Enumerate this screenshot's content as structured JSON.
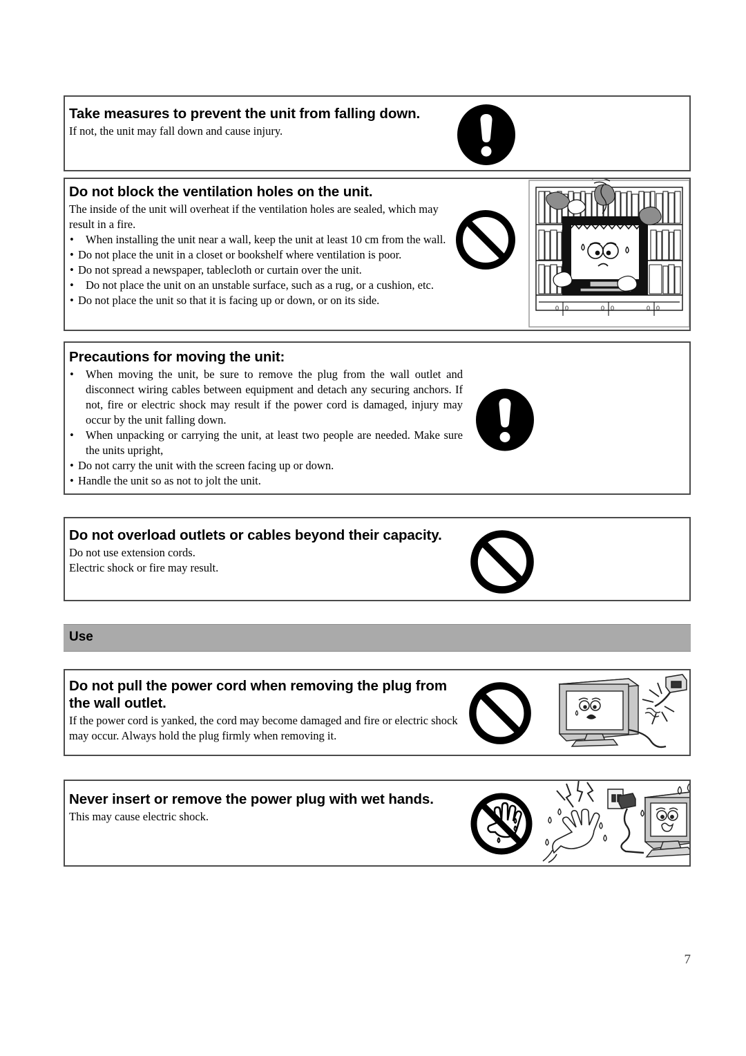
{
  "document": {
    "page_number": "7",
    "section_header": "Use"
  },
  "boxes": [
    {
      "id": "falling-down",
      "heading": "Take measures to prevent the unit from falling down.",
      "body": "If not, the unit may fall down and cause injury.",
      "icon": "exclamation-mark-icon"
    },
    {
      "id": "ventilation-holes",
      "heading": "Do not block the ventilation holes on the unit.",
      "body": "The inside of the unit will overheat if the ventilation holes are sealed, which may result in a fire.",
      "bullets": [
        "When installing the unit near a wall, keep the unit at least 10 cm from the wall.",
        "Do not place the unit in a closet or bookshelf where ventilation is poor.",
        "Do not spread a newspaper, tablecloth or curtain over the unit.",
        "Do not place the unit on an unstable surface, such as a rug, or a cushion, etc.",
        "Do not place the unit so that it is facing up or down, or on its side."
      ],
      "icon": "prohibition-icon",
      "illustration": "tv-in-bookshelf-overheating-illustration"
    },
    {
      "id": "moving-unit",
      "heading": "Precautions for moving the unit:",
      "bullets": [
        "When moving the unit, be sure to remove the plug from the wall outlet and disconnect wiring cables between equipment and detach any securing anchors. If not, fire or electric shock may result if the power cord is damaged, injury may occur by the unit falling down.",
        "When unpacking or carrying the unit, at least two people are needed. Make sure the units upright,",
        "Do not carry the unit with the screen facing up or down.",
        "Handle the unit so as not to jolt the unit."
      ],
      "icon": "exclamation-mark-icon"
    },
    {
      "id": "overload-outlets",
      "heading": "Do not overload outlets or cables beyond their capacity.",
      "body_lines": [
        "Do not use extension cords.",
        "Electric shock or fire may result."
      ],
      "icon": "prohibition-icon"
    },
    {
      "id": "power-cord-pull",
      "heading": "Do not pull the power cord when removing the plug from the wall outlet.",
      "body": "If the power cord is yanked, the cord may become damaged and fire or electric shock may occur. Always hold the plug firmly when removing it.",
      "icon": "prohibition-icon",
      "illustration": "tv-with-yanked-power-cord-illustration"
    },
    {
      "id": "wet-hands",
      "heading": "Never insert or remove the power plug with wet hands.",
      "body": "This may cause electric shock.",
      "icon": "no-wet-hands-icon",
      "illustration": "wet-hand-electric-shock-tv-illustration"
    }
  ],
  "colors": {
    "section_bar_bg": "#aaaaaa",
    "box_border": "#4a4a4a",
    "icon_black": "#000000",
    "illustration_gray": "#bfbfbf"
  }
}
